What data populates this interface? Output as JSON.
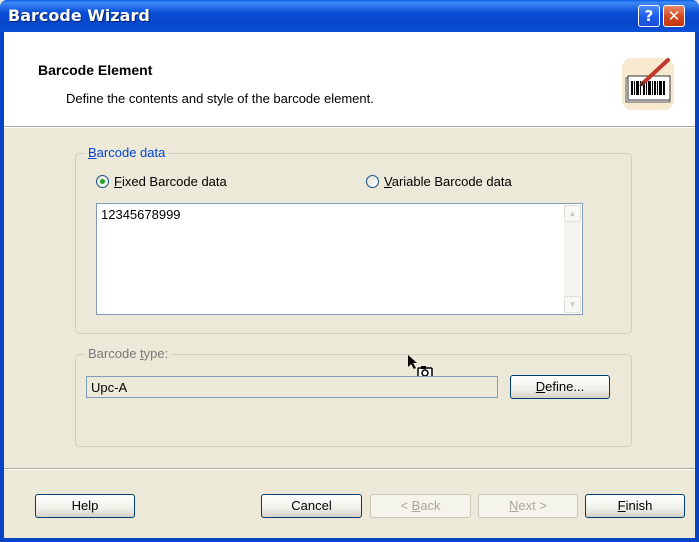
{
  "window": {
    "title": "Barcode Wizard",
    "help_glyph": "?",
    "close_glyph": "✕"
  },
  "header": {
    "title": "Barcode Element",
    "subtitle": "Define the contents and style of the barcode element.",
    "icon": "barcode-pen-icon"
  },
  "barcode_data": {
    "legend_first": "B",
    "legend_rest": "arcode data",
    "fixed_first": "F",
    "fixed_rest": "ixed Barcode data",
    "fixed_selected": true,
    "variable_first": "V",
    "variable_rest": "ariable Barcode data",
    "variable_selected": false,
    "value": "12345678999"
  },
  "barcode_type": {
    "legend_pre": "Barcode ",
    "legend_u": "t",
    "legend_post": "ype:",
    "value": "Upc-A",
    "define_first": "D",
    "define_rest": "efine..."
  },
  "footer": {
    "help_label": "Help",
    "cancel_label": "Cancel",
    "back_pre": "< ",
    "back_u": "B",
    "back_post": "ack",
    "next_u": "N",
    "next_post": "ext >",
    "finish_u": "F",
    "finish_post": "inish"
  },
  "colors": {
    "titlebar": "#0a52d8",
    "dialog_bg": "#ece9d8",
    "group_label": "#0046d5",
    "radio_dot": "#21a121"
  }
}
